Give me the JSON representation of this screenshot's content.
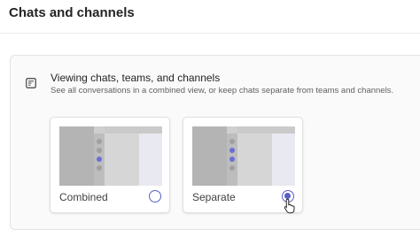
{
  "header": {
    "title": "Chats and channels"
  },
  "section": {
    "icon": "chat-settings-icon",
    "heading": "Viewing chats, teams, and channels",
    "description": "See all conversations in a combined view, or keep chats separate from teams and channels."
  },
  "options": [
    {
      "label": "Combined",
      "selected": false,
      "preview_icon": "combined-view-thumbnail"
    },
    {
      "label": "Separate",
      "selected": true,
      "preview_icon": "separate-view-thumbnail"
    }
  ],
  "colors": {
    "accent": "#5b5fc7",
    "panel_bg": "#fafafa",
    "border": "#e0e0e0"
  },
  "pointer": "hand-cursor-icon"
}
